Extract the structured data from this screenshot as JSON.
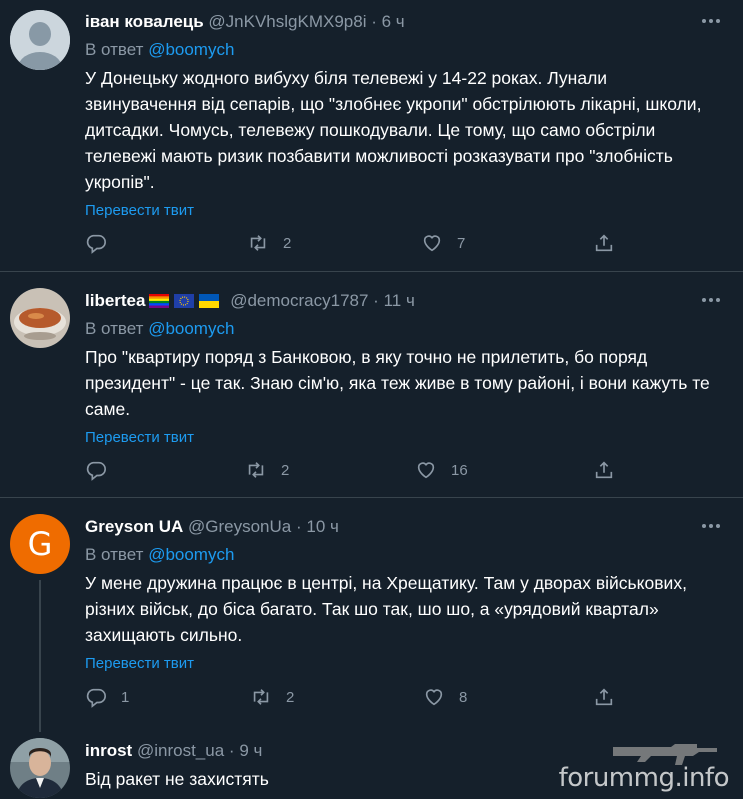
{
  "tweets": [
    {
      "name": "іван ковалець",
      "handle": "@JnKVhslgKMX9p8i",
      "time": "6 ч",
      "reply_label": "В ответ",
      "reply_to": "@boomych",
      "text": "У Донецьку жодного вибуху біля телевежі у 14-22 роках. Лунали звинувачення від сепарів, що \"злобнеє укропи\" обстрілюють лікарні, школи, дитсадки. Чомусь, телевежу пошкодували. Це тому, що само обстріли телевежі мають ризик позбавити можливості розказувати про \"злобність укропів\".",
      "translate": "Перевести твит",
      "replies": "",
      "retweets": "2",
      "likes": "7"
    },
    {
      "name": "libertea",
      "handle": "@democracy1787",
      "time": "11 ч",
      "reply_label": "В ответ",
      "reply_to": "@boomych",
      "text": "Про \"квартиру поряд з Банковою, в яку точно не прилетить, бо поряд президент\" - це так. Знаю сім'ю, яка теж живе в тому районі, і вони кажуть те саме.",
      "translate": "Перевести твит",
      "replies": "",
      "retweets": "2",
      "likes": "16"
    },
    {
      "name": "Greyson UA",
      "handle": "@GreysonUa",
      "time": "10 ч",
      "avatar_letter": "G",
      "reply_label": "В ответ",
      "reply_to": "@boomych",
      "text": "У мене дружина працює в центрі, на Хрещатику. Там у дворах військових, різних військ, до біса багато. Так шо так, шо шо, а «урядовий квартал» захищають сильно.",
      "translate": "Перевести твит",
      "replies": "1",
      "retweets": "2",
      "likes": "8"
    },
    {
      "name": "inrost",
      "handle": "@inrost_ua",
      "time": "9 ч",
      "text": "Від ракет не захистять"
    }
  ],
  "separator": "·",
  "watermark": "forummg.info",
  "colors": {
    "background": "#15202b",
    "accent": "#1d9bf0",
    "muted": "#8b98a5",
    "divider": "#38444d",
    "greyson_avatar": "#ef6c00"
  },
  "icons": [
    "more-icon",
    "reply-icon",
    "retweet-icon",
    "like-icon",
    "share-icon"
  ]
}
